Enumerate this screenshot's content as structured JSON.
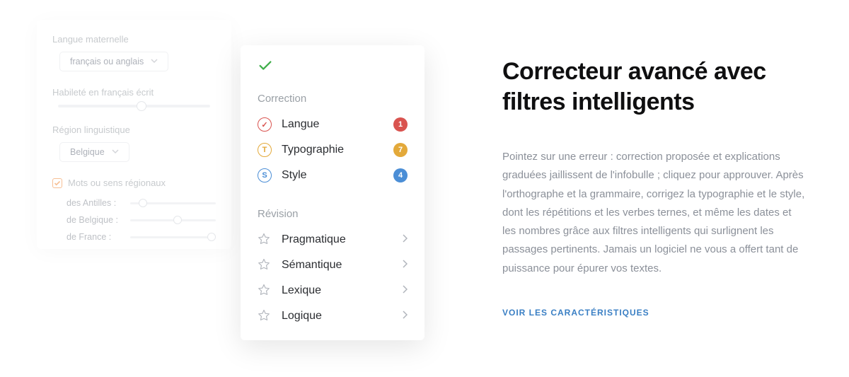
{
  "settings": {
    "langue_maternelle_label": "Langue maternelle",
    "langue_maternelle_value": "français ou anglais",
    "habilete_label": "Habileté en français écrit",
    "region_label": "Région linguistique",
    "region_value": "Belgique",
    "checkbox_label": "Mots ou sens régionaux",
    "regional": [
      {
        "label": "des Antilles :",
        "pos": 15
      },
      {
        "label": "de Belgique :",
        "pos": 55
      },
      {
        "label": "de France :",
        "pos": 95
      }
    ]
  },
  "correction_panel": {
    "heading_correction": "Correction",
    "heading_revision": "Révision",
    "correction_items": [
      {
        "label": "Langue",
        "icon_color": "#d9534f",
        "icon_glyph": "✓",
        "badge": "1",
        "badge_color": "#d9534f"
      },
      {
        "label": "Typographie",
        "icon_color": "#e3a93a",
        "icon_glyph": "T",
        "badge": "7",
        "badge_color": "#e3a93a"
      },
      {
        "label": "Style",
        "icon_color": "#4b8ed6",
        "icon_glyph": "S",
        "badge": "4",
        "badge_color": "#4b8ed6"
      }
    ],
    "revision_items": [
      {
        "label": "Pragmatique"
      },
      {
        "label": "Sémantique"
      },
      {
        "label": "Lexique"
      },
      {
        "label": "Logique"
      }
    ]
  },
  "marketing": {
    "headline": "Correcteur avancé avec filtres intelligents",
    "body": "Pointez sur une erreur : correction proposée et explications graduées jaillissent de l'infobulle ; cliquez pour approuver. Après l'orthographe et la grammaire, corrigez la typographie et le style, dont les répétitions et les verbes ternes, et même les dates et les nombres grâce aux filtres intelligents qui surlignent les passages pertinents. Jamais un logiciel ne vous a offert tant de puissance pour épurer vos textes.",
    "link": "VOIR LES CARACTÉRISTIQUES"
  }
}
